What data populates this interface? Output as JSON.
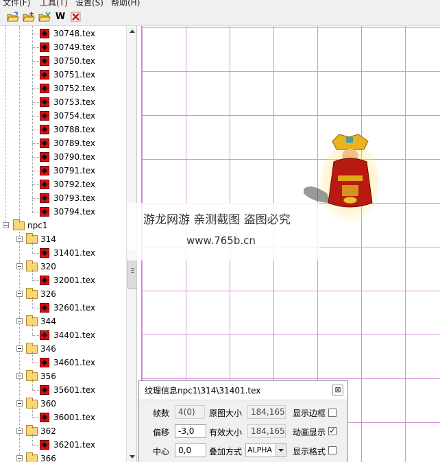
{
  "menu": [
    "文件(F)",
    "工具(T)",
    "设置(S)",
    "帮助(H)"
  ],
  "toolbar": {
    "buttons": [
      {
        "name": "open-folder-icon"
      },
      {
        "name": "open-folder-add-icon"
      },
      {
        "name": "open-folder-green-icon"
      },
      {
        "name": "w-label-icon",
        "label": "W"
      },
      {
        "name": "delete-icon"
      }
    ]
  },
  "tree": {
    "root_label": "npc1",
    "top_files": [
      "30748.tex",
      "30749.tex",
      "30750.tex",
      "30751.tex",
      "30752.tex",
      "30753.tex",
      "30754.tex",
      "30788.tex",
      "30789.tex",
      "30790.tex",
      "30791.tex",
      "30792.tex",
      "30793.tex",
      "30794.tex"
    ],
    "folders": [
      {
        "label": "314",
        "file": "31401.tex"
      },
      {
        "label": "320",
        "file": "32001.tex"
      },
      {
        "label": "326",
        "file": "32601.tex"
      },
      {
        "label": "344",
        "file": "34401.tex"
      },
      {
        "label": "346",
        "file": "34601.tex"
      },
      {
        "label": "356",
        "file": "35601.tex"
      },
      {
        "label": "360",
        "file": "36001.tex"
      },
      {
        "label": "362",
        "file": "36201.tex"
      },
      {
        "label": "366",
        "file": ""
      }
    ]
  },
  "watermark": {
    "line1": "游龙网游 亲测截图 盗图必究",
    "line2": "www.765b.cn"
  },
  "info_panel": {
    "title": "纹理信息npc1\\314\\31401.tex",
    "close_glyph": "⊠",
    "frames_label": "帧数",
    "frames_value": "4(0)",
    "orig_size_label": "原图大小",
    "orig_size_value": "184,165",
    "show_border_label": "显示边框",
    "show_border_checked": false,
    "offset_label": "偏移",
    "offset_value": "-3,0",
    "valid_size_label": "有效大小",
    "valid_size_value": "184,165",
    "anim_label": "动画显示",
    "anim_checked": true,
    "center_label": "中心",
    "center_value": "0,0",
    "blend_label": "叠加方式",
    "blend_value": "ALPHA",
    "show_format_label": "显示格式",
    "show_format_checked": false
  },
  "colors": {
    "grid_line": "#d98ee0",
    "file_icon": "#e30b0b",
    "folder_icon": "#f7d773",
    "menu_bg": "#f0f0f0"
  }
}
